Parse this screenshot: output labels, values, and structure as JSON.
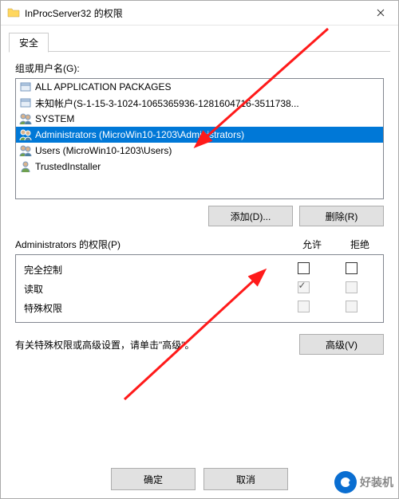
{
  "title": "InProcServer32 的权限",
  "tab": "安全",
  "group_label": "组或用户名(G):",
  "list_items": [
    {
      "label": "ALL APPLICATION PACKAGES",
      "icon": "package"
    },
    {
      "label": "未知帐户(S-1-15-3-1024-1065365936-1281604716-3511738...",
      "icon": "package"
    },
    {
      "label": "SYSTEM",
      "icon": "people"
    },
    {
      "label": "Administrators (MicroWin10-1203\\Administrators)",
      "icon": "people",
      "selected": true
    },
    {
      "label": "Users (MicroWin10-1203\\Users)",
      "icon": "people"
    },
    {
      "label": "TrustedInstaller",
      "icon": "person"
    }
  ],
  "buttons": {
    "add": "添加(D)...",
    "remove": "删除(R)",
    "advanced": "高级(V)",
    "ok": "确定",
    "cancel": "取消"
  },
  "perm_header": "Administrators 的权限(P)",
  "col_allow": "允许",
  "col_deny": "拒绝",
  "perms": [
    {
      "name": "完全控制",
      "allow": false,
      "deny": false,
      "disabled": false
    },
    {
      "name": "读取",
      "allow": true,
      "deny": false,
      "disabled": true
    },
    {
      "name": "特殊权限",
      "allow": false,
      "deny": false,
      "disabled": true
    }
  ],
  "advanced_text": "有关特殊权限或高级设置，请单击\"高级\"。",
  "watermark": "好装机"
}
